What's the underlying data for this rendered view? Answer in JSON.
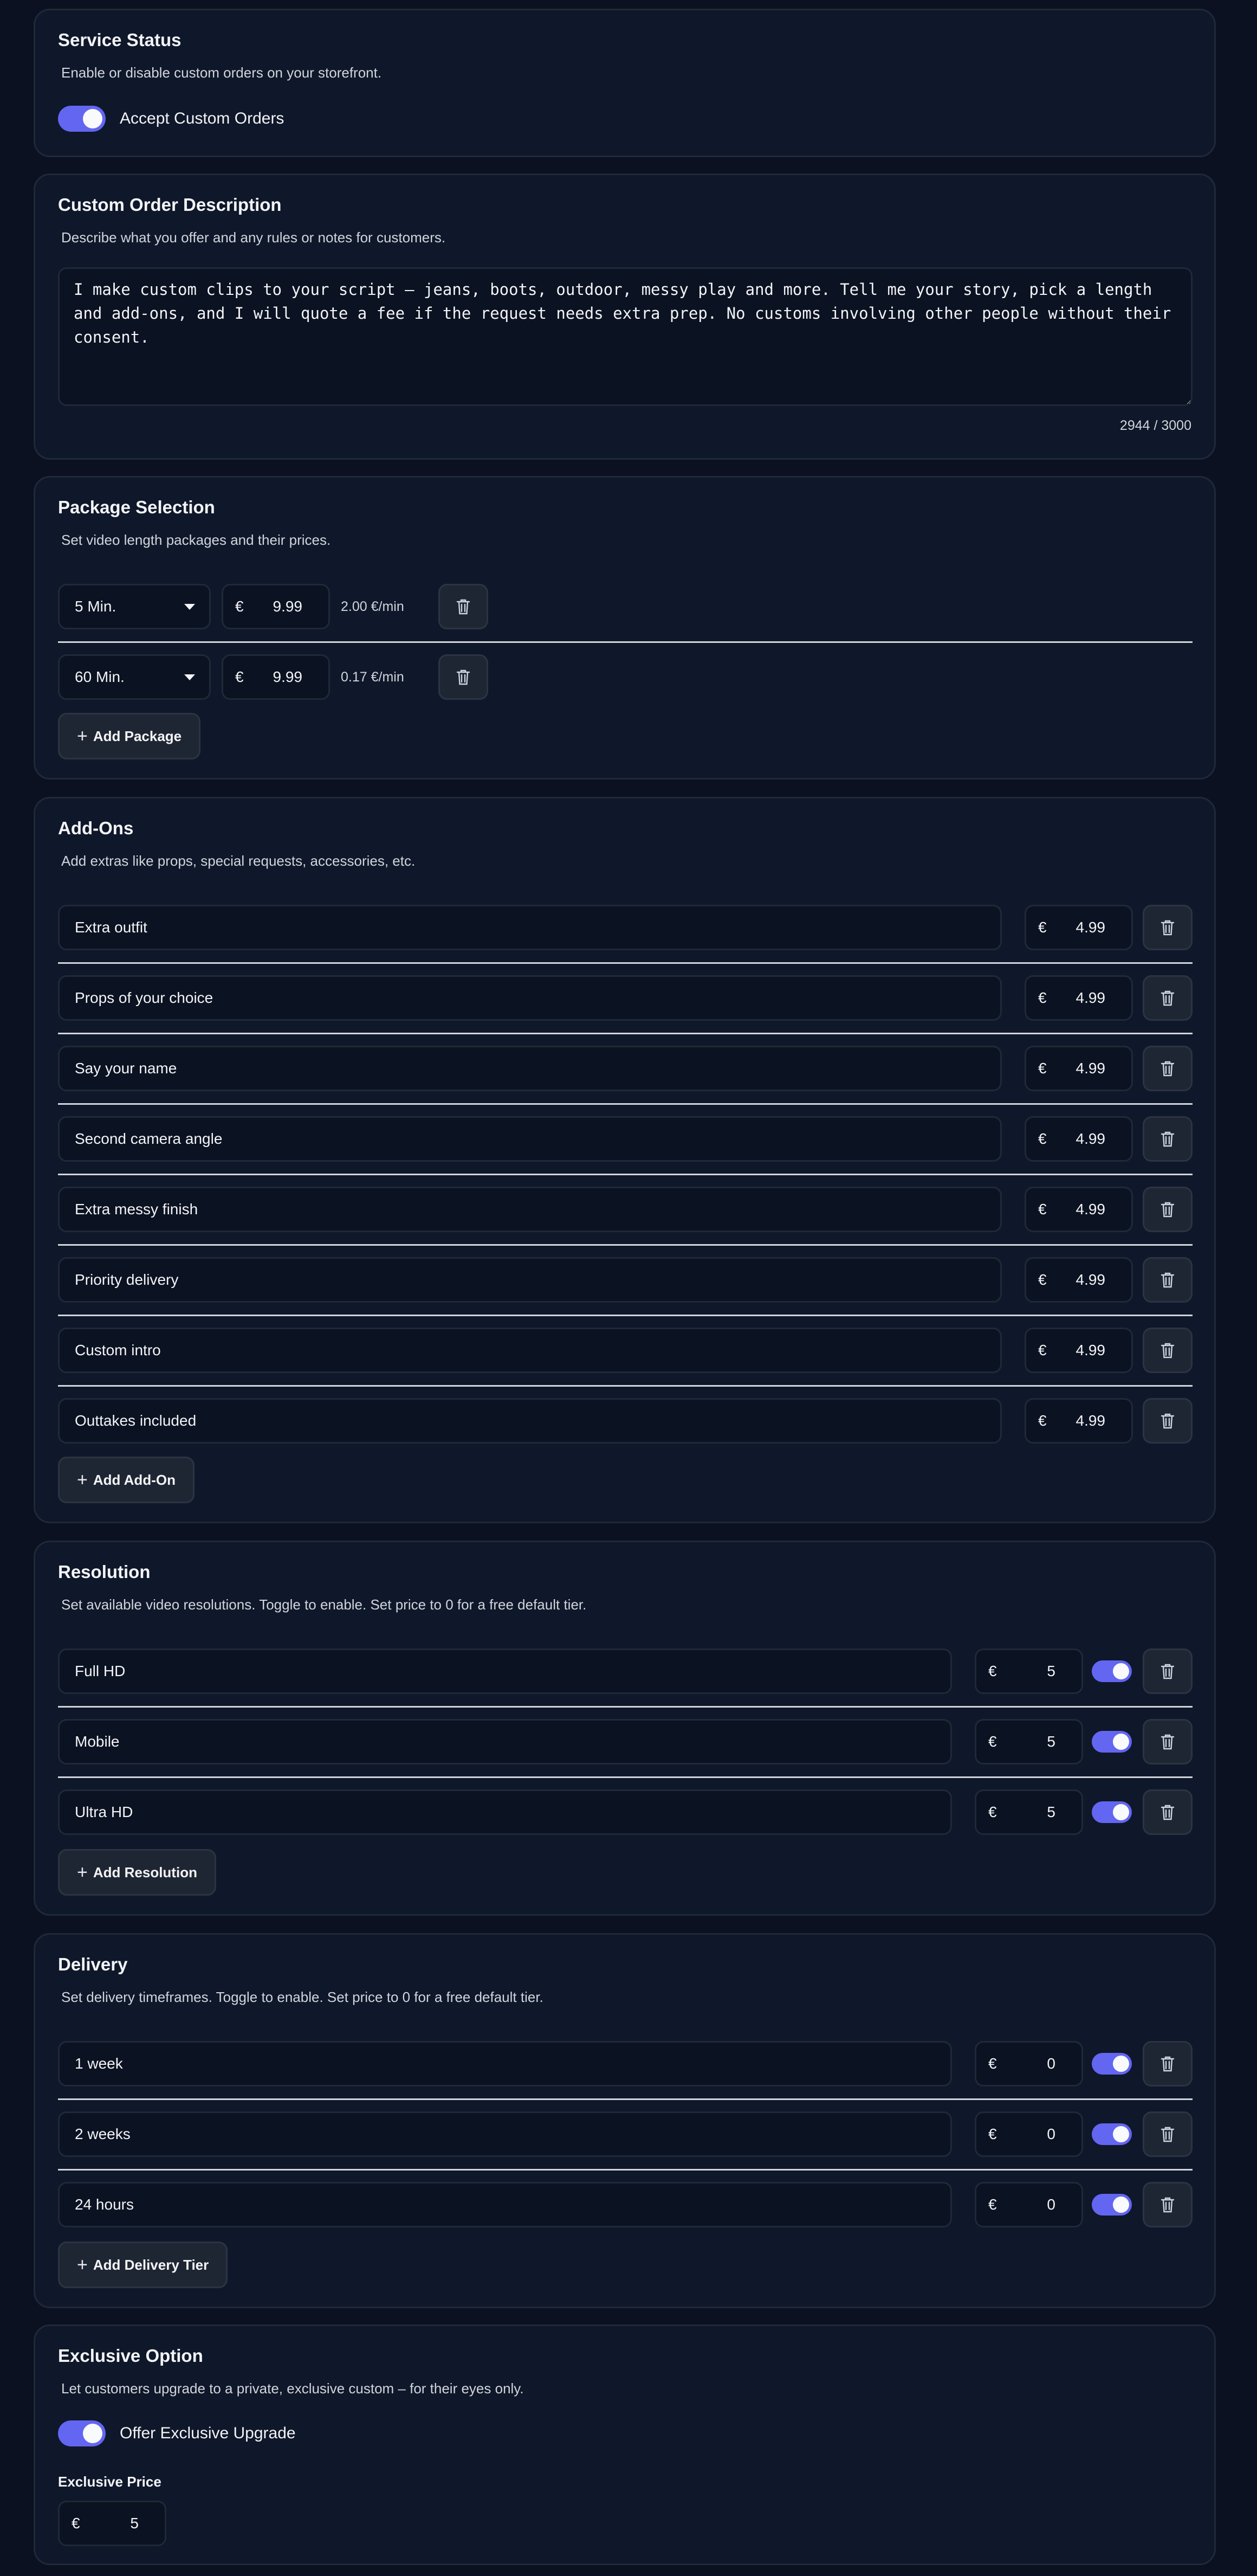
{
  "service_status": {
    "title": "Service Status",
    "description": "Enable or disable custom orders on your storefront.",
    "toggle_label": "Accept Custom Orders"
  },
  "custom_description": {
    "title": "Custom Order Description",
    "description": "Describe what you offer and any rules or notes for customers.",
    "text": "I make custom clips to your script — jeans, boots, outdoor, messy play and more. Tell me your story, pick a length and add-ons, and I will quote a fee if the request needs extra prep. No customs involving other people without their consent.",
    "counter": "2944 / 3000"
  },
  "packages": {
    "title": "Package Selection",
    "description": "Set video length packages and their prices.",
    "items": [
      {
        "length": "5 Min.",
        "currency": "€",
        "price": "9.99",
        "rate": "2.00 €/min"
      },
      {
        "length": "60 Min.",
        "currency": "€",
        "price": "9.99",
        "rate": "0.17 €/min"
      }
    ],
    "add_label": "Add Package"
  },
  "addons": {
    "title": "Add-Ons",
    "description": "Add extras like props, special requests, accessories, etc.",
    "items": [
      {
        "name": "Extra outfit",
        "currency": "€",
        "price": "4.99"
      },
      {
        "name": "Props of your choice",
        "currency": "€",
        "price": "4.99"
      },
      {
        "name": "Say your name",
        "currency": "€",
        "price": "4.99"
      },
      {
        "name": "Second camera angle",
        "currency": "€",
        "price": "4.99"
      },
      {
        "name": "Extra messy finish",
        "currency": "€",
        "price": "4.99"
      },
      {
        "name": "Priority delivery",
        "currency": "€",
        "price": "4.99"
      },
      {
        "name": "Custom intro",
        "currency": "€",
        "price": "4.99"
      },
      {
        "name": "Outtakes included",
        "currency": "€",
        "price": "4.99"
      }
    ],
    "add_label": "Add Add-On"
  },
  "resolution": {
    "title": "Resolution",
    "description": "Set available video resolutions. Toggle to enable. Set price to 0 for a free default tier.",
    "items": [
      {
        "name": "Full HD",
        "currency": "€",
        "price": "5",
        "enabled": true
      },
      {
        "name": "Mobile",
        "currency": "€",
        "price": "5",
        "enabled": true
      },
      {
        "name": "Ultra HD",
        "currency": "€",
        "price": "5",
        "enabled": true
      }
    ],
    "add_label": "Add Resolution"
  },
  "delivery": {
    "title": "Delivery",
    "description": "Set delivery timeframes. Toggle to enable. Set price to 0 for a free default tier.",
    "items": [
      {
        "name": "1 week",
        "currency": "€",
        "price": "0",
        "enabled": true
      },
      {
        "name": "2 weeks",
        "currency": "€",
        "price": "0",
        "enabled": true
      },
      {
        "name": "24 hours",
        "currency": "€",
        "price": "0",
        "enabled": true
      }
    ],
    "add_label": "Add Delivery Tier"
  },
  "exclusive": {
    "title": "Exclusive Option",
    "description": "Let customers upgrade to a private, exclusive custom – for their eyes only.",
    "toggle_label": "Offer Exclusive Upgrade",
    "price_label": "Exclusive Price",
    "currency": "€",
    "price": "5"
  },
  "colors": {
    "accent": "#6366f1",
    "background": "#0b1120",
    "card": "#0f172a"
  }
}
